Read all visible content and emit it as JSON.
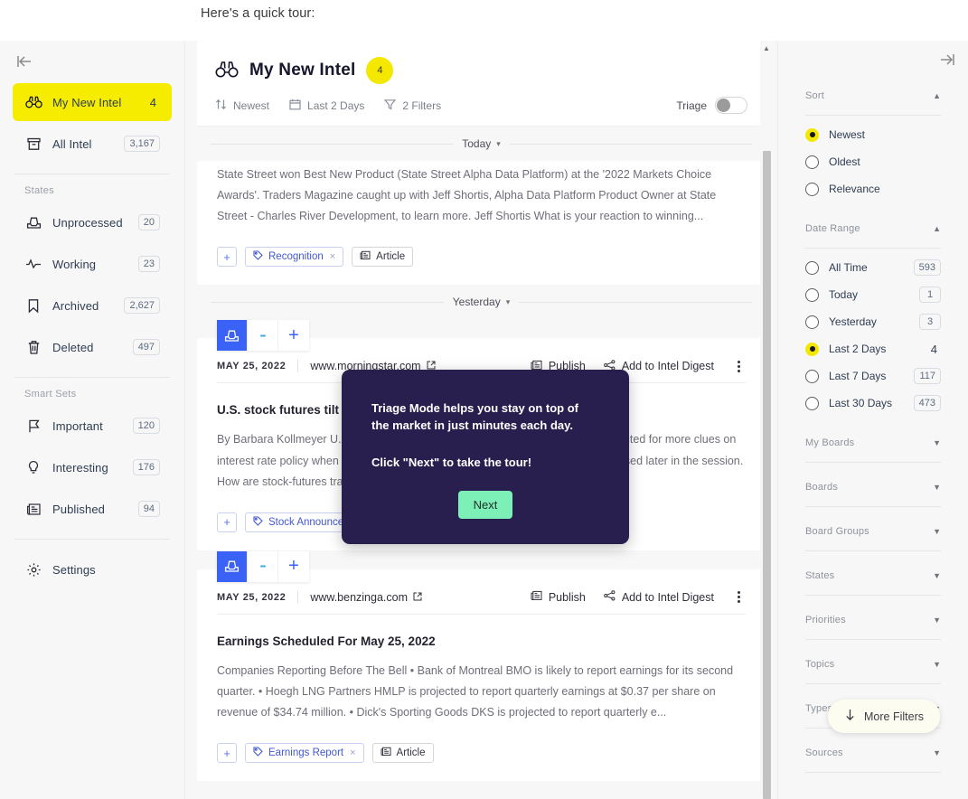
{
  "tour": {
    "caption": "Here's a quick tour:",
    "modal": {
      "line1": "Triage Mode helps you stay on top of the market in just minutes each day.",
      "line2": "Click \"Next\" to take the tour!",
      "next_label": "Next"
    }
  },
  "sidebar": {
    "collapse_icon": "collapse-left-icon",
    "primary": [
      {
        "icon": "binoculars-icon",
        "label": "My New Intel",
        "count": "4",
        "active": true,
        "boxed": false
      },
      {
        "icon": "archive-box-icon",
        "label": "All Intel",
        "count": "3,167",
        "active": false,
        "boxed": true
      }
    ],
    "states_label": "States",
    "states": [
      {
        "icon": "inbox-icon",
        "label": "Unprocessed",
        "count": "20"
      },
      {
        "icon": "activity-pulse-icon",
        "label": "Working",
        "count": "23"
      },
      {
        "icon": "bookmark-icon",
        "label": "Archived",
        "count": "2,627"
      },
      {
        "icon": "trash-icon",
        "label": "Deleted",
        "count": "497"
      }
    ],
    "smart_sets_label": "Smart Sets",
    "smart_sets": [
      {
        "icon": "flag-icon",
        "label": "Important",
        "count": "120"
      },
      {
        "icon": "lightbulb-icon",
        "label": "Interesting",
        "count": "176"
      },
      {
        "icon": "newspaper-icon",
        "label": "Published",
        "count": "94"
      }
    ],
    "settings": {
      "icon": "gear-icon",
      "label": "Settings"
    }
  },
  "feed": {
    "header": {
      "icon": "binoculars-icon",
      "title": "My New Intel",
      "badge": "4",
      "tools": [
        {
          "icon": "sort-arrows-icon",
          "label": "Newest"
        },
        {
          "icon": "calendar-icon",
          "label": "Last 2 Days"
        },
        {
          "icon": "funnel-icon",
          "label": "2 Filters"
        }
      ],
      "triage_label": "Triage",
      "triage_on": false
    },
    "separators": {
      "today": "Today",
      "yesterday": "Yesterday"
    },
    "cards": [
      {
        "clipped": true,
        "body": "State Street won Best New Product (State Street Alpha Data Platform) at the '2022 Markets Choice Awards'. Traders Magazine caught up with Jeff Shortis, Alpha Data Platform Product Owner at State Street - Charles River Development, to learn more. Jeff Shortis What is your reaction to winning...",
        "tags": [
          {
            "label": "Recognition",
            "style": "blue",
            "removable": true
          },
          {
            "label": "Article",
            "style": "gray",
            "removable": false
          }
        ]
      },
      {
        "clipped": false,
        "date": "MAY 25, 2022",
        "source": "www.morningstar.com",
        "actions": [
          {
            "icon": "publish-icon",
            "label": "Publish"
          },
          {
            "icon": "share-icon",
            "label": "Add to Intel Digest"
          }
        ],
        "title": "U.S. stock futures tilt south",
        "body": "By Barbara Kollmeyer U.S. stock futures edged lower Wednesday as investors waited for more clues on interest rate policy when minutes from the last Federal Reserve meeting are released later in the session. How are stock-futures trading...",
        "tags": [
          {
            "label": "Stock Announcement",
            "style": "blue",
            "removable": true
          }
        ]
      },
      {
        "clipped": false,
        "date": "MAY 25, 2022",
        "source": "www.benzinga.com",
        "actions": [
          {
            "icon": "publish-icon",
            "label": "Publish"
          },
          {
            "icon": "share-icon",
            "label": "Add to Intel Digest"
          }
        ],
        "title": "Earnings Scheduled For May 25, 2022",
        "body": "  Companies Reporting Before The Bell • Bank of Montreal BMO is likely to report earnings for its second quarter. • Hoegh LNG Partners HMLP is projected to report quarterly earnings at $0.37 per share on revenue of $34.74 million. • Dick's Sporting Goods DKS is projected to report quarterly e...",
        "tags": [
          {
            "label": "Earnings Report",
            "style": "blue",
            "removable": true
          },
          {
            "label": "Article",
            "style": "gray",
            "removable": false
          }
        ]
      }
    ],
    "state_buttons": [
      {
        "icon": "inbox-icon",
        "active": true
      },
      {
        "icon": "partial-icon",
        "active": false
      },
      {
        "icon": "plus-icon",
        "active": false
      }
    ]
  },
  "filters": {
    "collapse_icon": "collapse-right-icon",
    "sort": {
      "title": "Sort",
      "options": [
        {
          "label": "Newest",
          "selected": true
        },
        {
          "label": "Oldest",
          "selected": false
        },
        {
          "label": "Relevance",
          "selected": false
        }
      ]
    },
    "date_range": {
      "title": "Date Range",
      "options": [
        {
          "label": "All Time",
          "count": "593",
          "selected": false
        },
        {
          "label": "Today",
          "count": "1",
          "selected": false
        },
        {
          "label": "Yesterday",
          "count": "3",
          "selected": false
        },
        {
          "label": "Last 2 Days",
          "count": "4",
          "selected": true
        },
        {
          "label": "Last 7 Days",
          "count": "117",
          "selected": false
        },
        {
          "label": "Last 30 Days",
          "count": "473",
          "selected": false
        }
      ]
    },
    "collapsed_sections": [
      "My Boards",
      "Boards",
      "Board Groups",
      "States",
      "Priorities",
      "Topics",
      "Types",
      "Sources"
    ],
    "more_filters": {
      "icon": "arrow-down-icon",
      "label": "More Filters"
    }
  }
}
